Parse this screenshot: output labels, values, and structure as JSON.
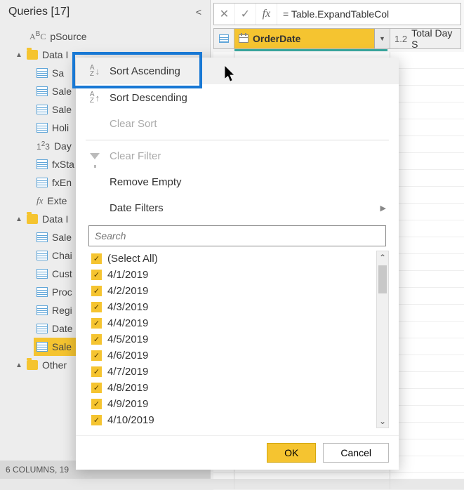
{
  "sidebar": {
    "title": "Queries [17]",
    "items": [
      {
        "type": "param",
        "icon": "abc",
        "label": "pSource"
      },
      {
        "type": "folder",
        "label": "Data I",
        "caret": "▲"
      },
      {
        "type": "leaf",
        "icon": "table",
        "label": "Sa"
      },
      {
        "type": "leaf",
        "icon": "table",
        "label": "Sale"
      },
      {
        "type": "leaf",
        "icon": "table",
        "label": "Sale"
      },
      {
        "type": "leaf",
        "icon": "table",
        "label": "Holi"
      },
      {
        "type": "leaf",
        "icon": "num",
        "label": "Day"
      },
      {
        "type": "leaf",
        "icon": "table",
        "label": "fxStа"
      },
      {
        "type": "leaf",
        "icon": "table",
        "label": "fxEn"
      },
      {
        "type": "leaf",
        "icon": "fx",
        "label": "Exte"
      },
      {
        "type": "folder",
        "label": "Data I",
        "caret": "▲"
      },
      {
        "type": "leaf",
        "icon": "table",
        "label": "Sale"
      },
      {
        "type": "leaf",
        "icon": "table",
        "label": "Chai"
      },
      {
        "type": "leaf",
        "icon": "table",
        "label": "Cust"
      },
      {
        "type": "leaf",
        "icon": "table",
        "label": "Proc"
      },
      {
        "type": "leaf",
        "icon": "table",
        "label": "Regi"
      },
      {
        "type": "leaf",
        "icon": "table",
        "label": "Date"
      },
      {
        "type": "leaf",
        "icon": "table",
        "label": "Sale",
        "selected": true
      },
      {
        "type": "folder",
        "label": "Other",
        "caret": "▲"
      }
    ],
    "status": "6 COLUMNS, 19"
  },
  "formula_bar": "= Table.ExpandTableCol",
  "columns": {
    "active": "OrderDate",
    "inactive": "Total Day S"
  },
  "filter_menu": {
    "sort_asc": "Sort Ascending",
    "sort_desc": "Sort Descending",
    "clear_sort": "Clear Sort",
    "clear_filter": "Clear Filter",
    "remove_empty": "Remove Empty",
    "date_filters": "Date Filters",
    "search_placeholder": "Search",
    "select_all": "(Select All)",
    "values": [
      "4/1/2019",
      "4/2/2019",
      "4/3/2019",
      "4/4/2019",
      "4/5/2019",
      "4/6/2019",
      "4/7/2019",
      "4/8/2019",
      "4/9/2019",
      "4/10/2019"
    ],
    "ok": "OK",
    "cancel": "Cancel"
  }
}
